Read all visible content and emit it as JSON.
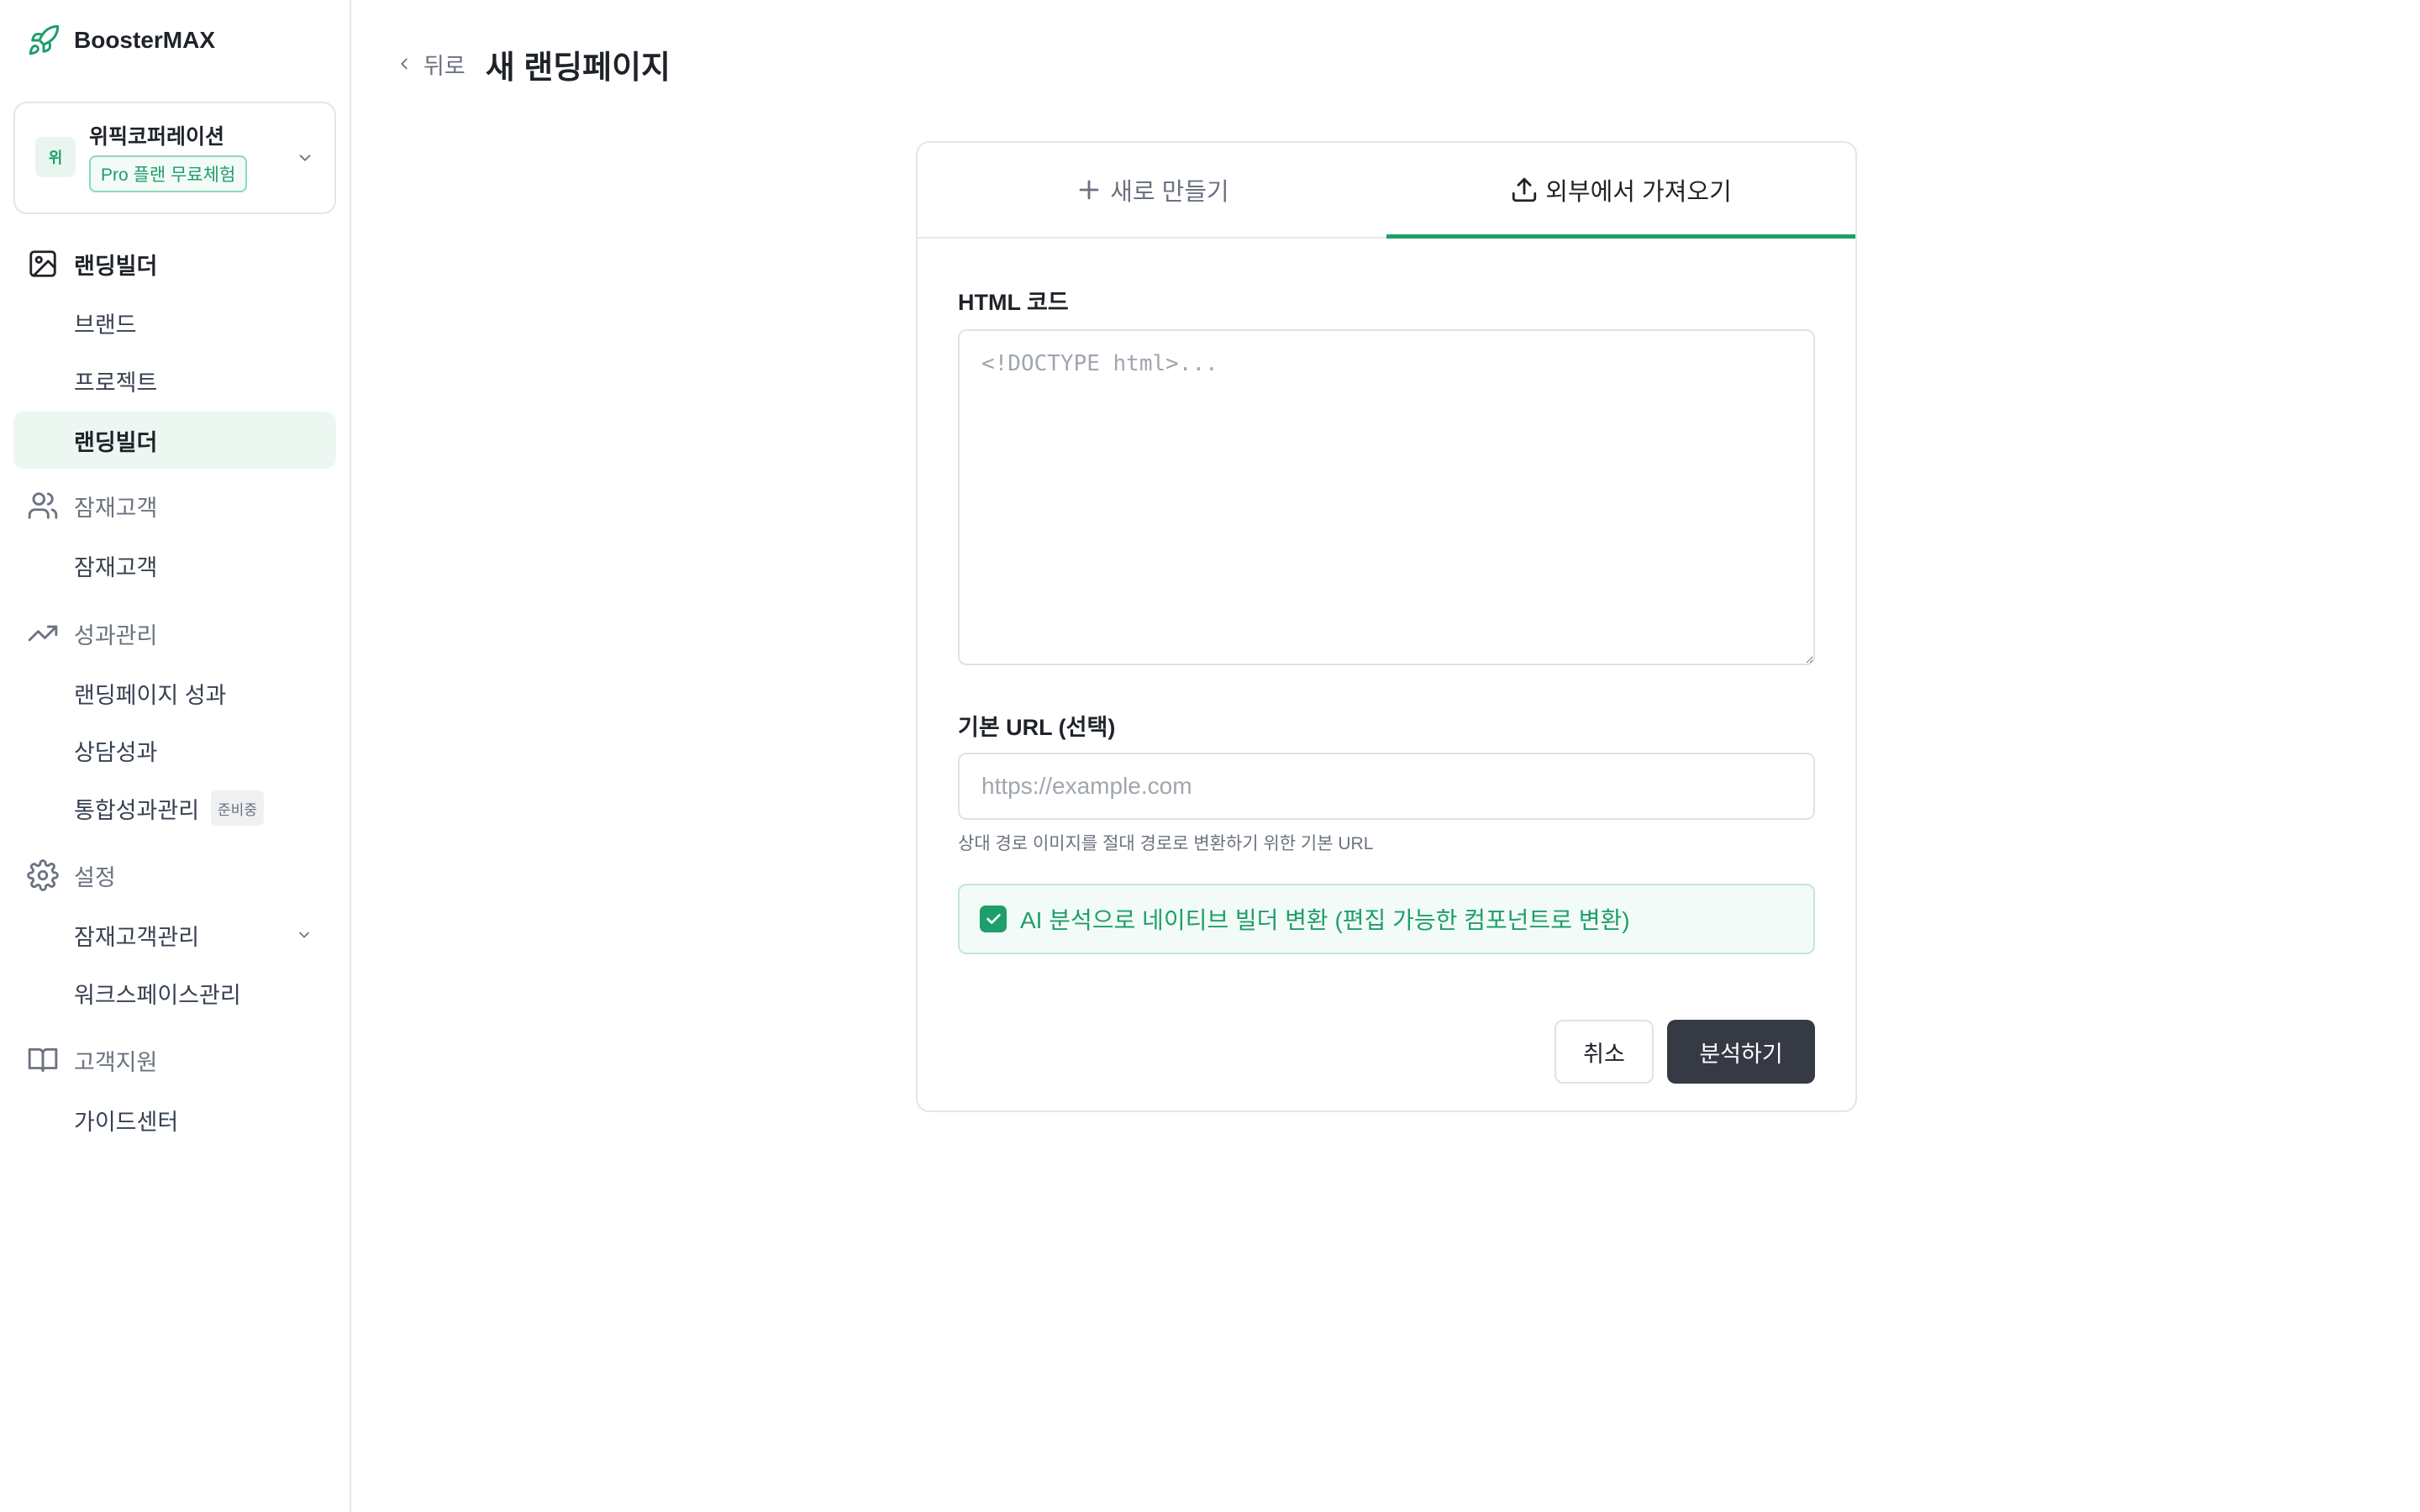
{
  "brand": {
    "name": "BoosterMAX"
  },
  "workspace": {
    "avatar_text": "위",
    "name": "위픽코퍼레이션",
    "plan_badge": "Pro 플랜 무료체험"
  },
  "sidebar": {
    "sections": [
      {
        "label": "랜딩빌더",
        "icon": "image-icon",
        "active": true,
        "items": [
          "브랜드",
          "프로젝트",
          "랜딩빌더"
        ],
        "selected_item": "랜딩빌더"
      },
      {
        "label": "잠재고객",
        "icon": "users-icon",
        "items": [
          "잠재고객"
        ]
      },
      {
        "label": "성과관리",
        "icon": "trending-up-icon",
        "items": [
          "랜딩페이지 성과",
          "상담성과",
          "통합성과관리"
        ],
        "item_badge": "준비중"
      },
      {
        "label": "설정",
        "icon": "gear-icon",
        "items": [
          "잠재고객관리",
          "워크스페이스관리"
        ]
      },
      {
        "label": "고객지원",
        "icon": "book-icon",
        "items": [
          "가이드센터"
        ]
      }
    ]
  },
  "header": {
    "back_label": "뒤로",
    "title": "새 랜딩페이지"
  },
  "tabs": [
    {
      "label": "새로 만들기",
      "icon": "plus-icon",
      "active": false
    },
    {
      "label": "외부에서 가져오기",
      "icon": "upload-icon",
      "active": true
    }
  ],
  "form": {
    "html_label": "HTML 코드",
    "html_value": "",
    "html_placeholder": "<!DOCTYPE html>...",
    "url_label": "기본 URL (선택)",
    "url_value": "",
    "url_placeholder": "https://example.com",
    "url_hint": "상대 경로 이미지를 절대 경로로 변환하기 위한 기본 URL",
    "ai_checkbox_label": "AI 분석으로 네이티브 빌더 변환 (편집 가능한 컴포넌트로 변환)",
    "ai_checked": true
  },
  "actions": {
    "cancel_label": "취소",
    "submit_label": "분석하기"
  },
  "colors": {
    "accent": "#1e9e6a",
    "primary_button": "#353a44",
    "selected_bg": "#edf7f2"
  }
}
